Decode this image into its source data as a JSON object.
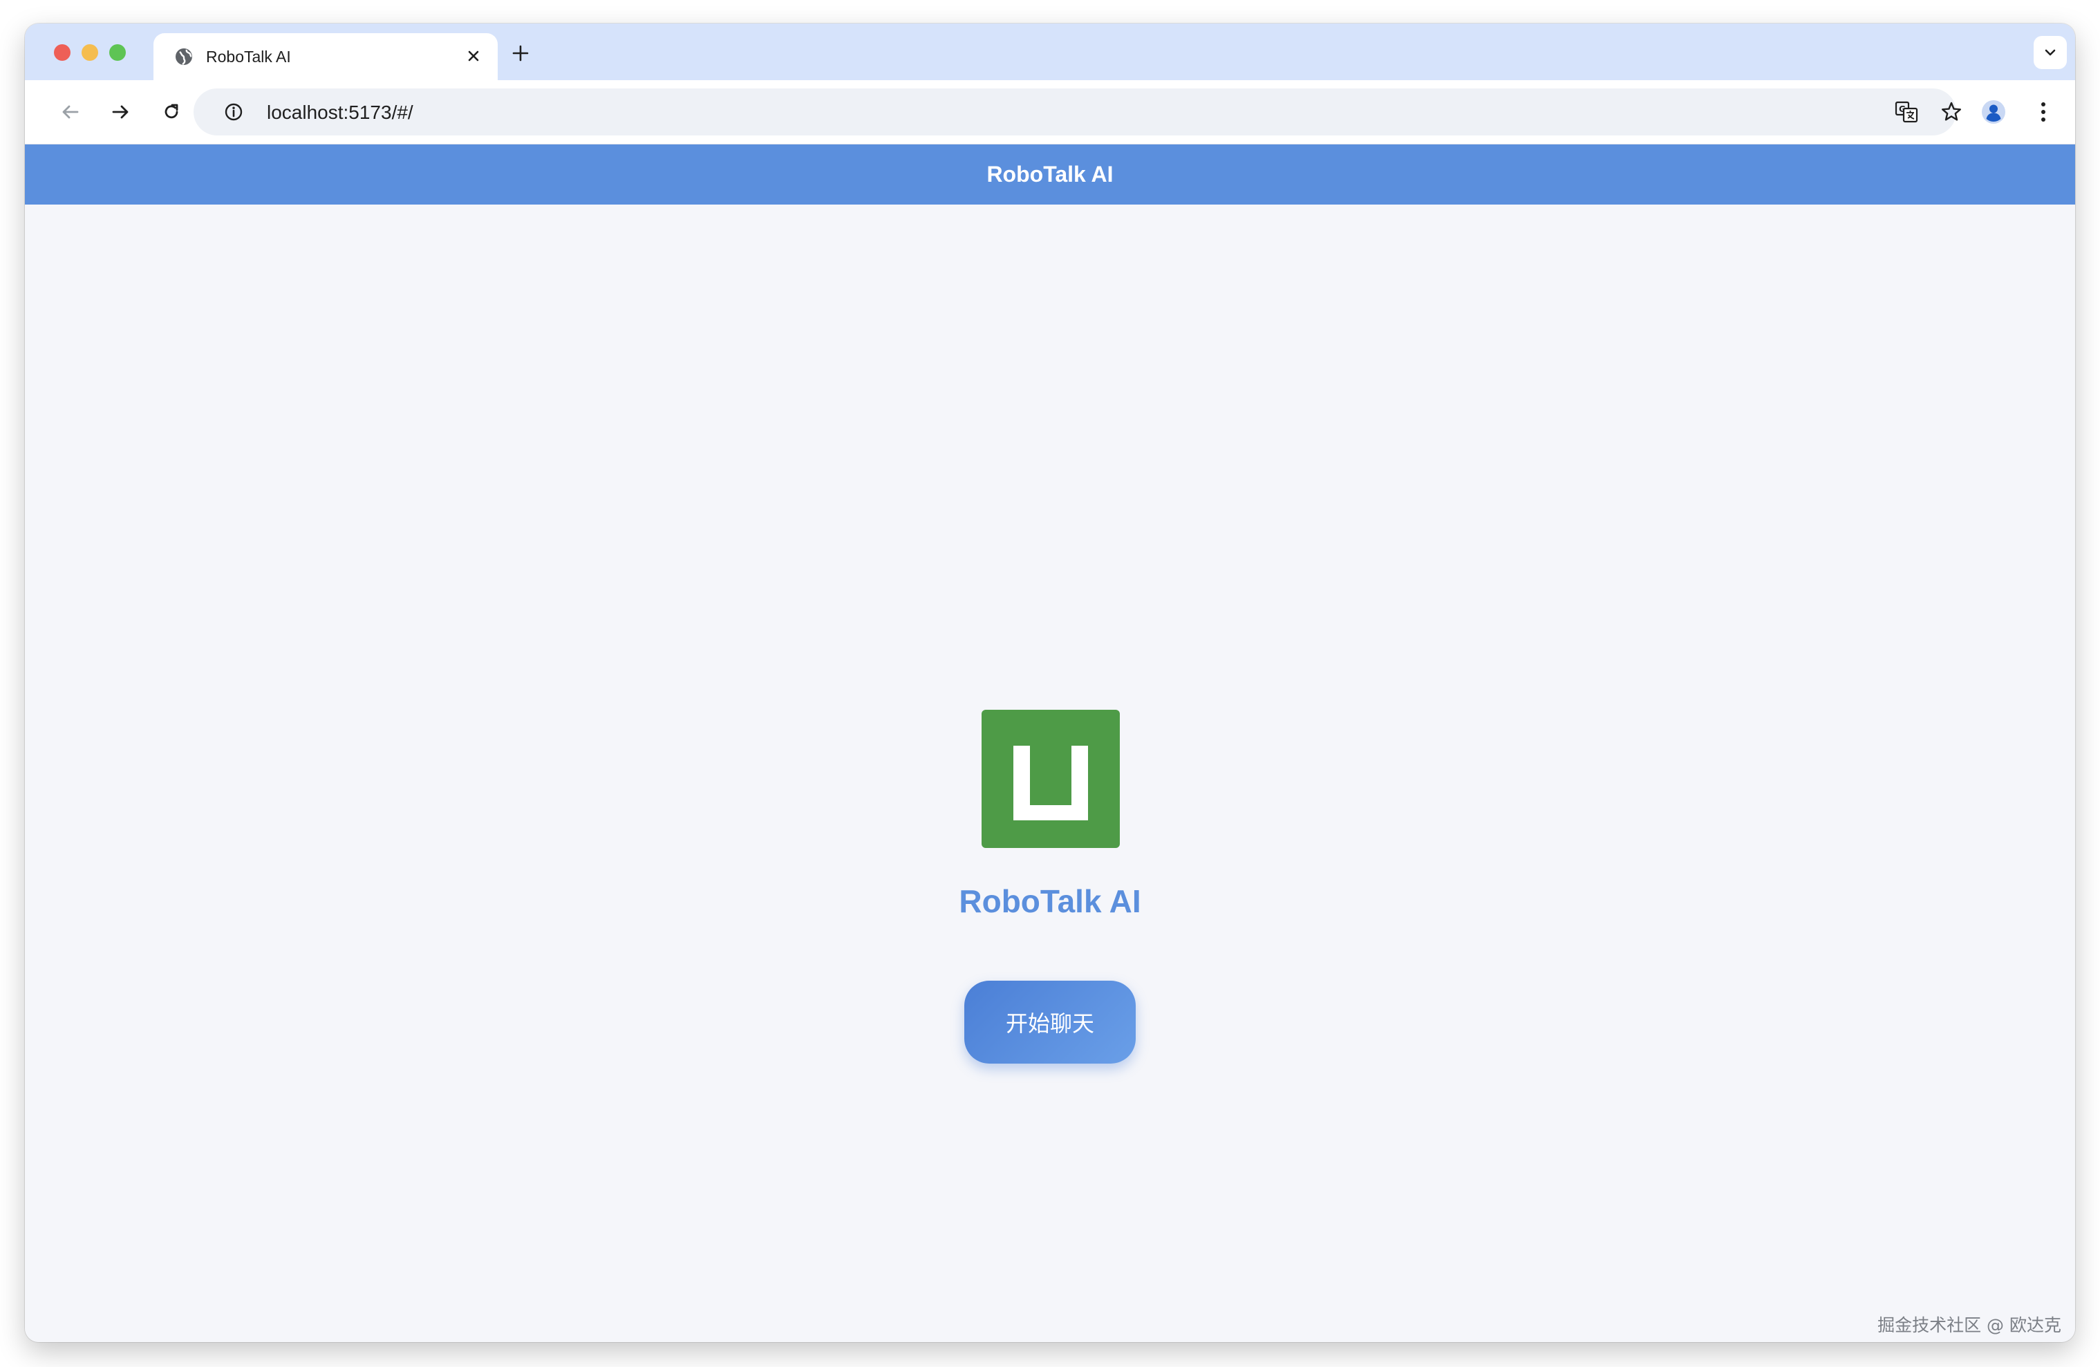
{
  "browser": {
    "tab": {
      "title": "RoboTalk AI"
    },
    "address_bar": {
      "url": "localhost:5173/#/"
    },
    "icons": {
      "tab_favicon": "globe-icon",
      "tab_close": "close-icon",
      "new_tab": "plus-icon",
      "tab_search": "chevron-down-icon",
      "back": "arrow-left-icon",
      "forward": "arrow-right-icon",
      "reload": "reload-icon",
      "site_info": "info-icon",
      "translate": "translate-icon",
      "bookmark": "star-icon",
      "profile": "profile-icon",
      "menu": "kebab-menu-icon"
    }
  },
  "app": {
    "header_title": "RoboTalk AI",
    "logo_icon": "app-logo-icon",
    "hero_title": "RoboTalk AI",
    "start_button_label": "开始聊天",
    "watermark": "掘金技术社区 @ 欧达克"
  },
  "colors": {
    "header_bg": "#5b8fdd",
    "logo_bg": "#4e9b47",
    "accent": "#5b8fdd",
    "button_start": "#4b7fd6",
    "button_end": "#6a9fe8",
    "page_bg": "#f5f6fa",
    "tabstrip_bg": "#d6e3fb"
  }
}
